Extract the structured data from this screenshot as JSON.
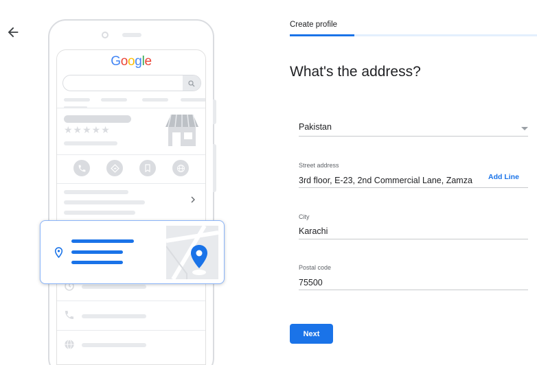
{
  "nav": {
    "back_icon": "arrow-back-icon"
  },
  "illustration": {
    "logo": {
      "G": "G",
      "o1": "o",
      "o2": "o",
      "g": "g",
      "l": "l",
      "e": "e"
    },
    "stars": "★★★★★",
    "icons": [
      "phone-icon",
      "directions-icon",
      "bookmark-icon",
      "globe-icon",
      "chevron-right-icon",
      "location-pin-icon",
      "clock-icon"
    ]
  },
  "form": {
    "tab_label": "Create profile",
    "progress": 0.26,
    "heading": "What's the address?",
    "country": {
      "value": "Pakistan"
    },
    "street": {
      "label": "Street address",
      "value": "3rd floor, E-23, 2nd Commercial Lane, Zamza",
      "add_line": "Add Line"
    },
    "city": {
      "label": "City",
      "value": "Karachi"
    },
    "postal": {
      "label": "Postal code",
      "value": "75500"
    },
    "next_label": "Next"
  },
  "colors": {
    "accent": "#1a73e8",
    "text": "#202124",
    "muted": "#5f6368",
    "border": "#dadce0"
  }
}
